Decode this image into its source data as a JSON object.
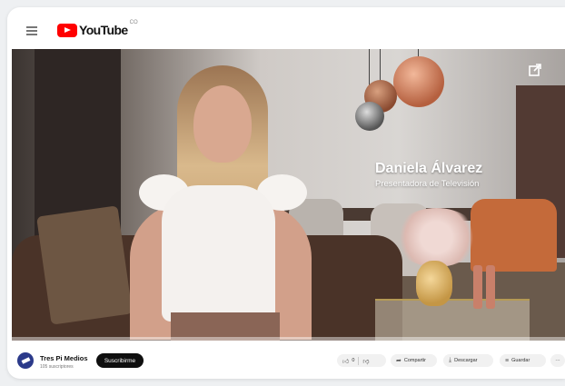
{
  "header": {
    "logo_text": "YouTube",
    "country_code": "CO"
  },
  "video": {
    "overlay_name": "Daniela Álvarez",
    "overlay_role": "Presentadora de Televisión"
  },
  "channel": {
    "name": "Tres Pi Medios",
    "subscribers": "105 suscriptores",
    "subscribe_label": "Suscribirme"
  },
  "actions": {
    "likes": "0",
    "share_label": "Compartir",
    "download_label": "Descargar",
    "save_label": "Guardar",
    "more_label": "···"
  },
  "colors": {
    "brand_red": "#ff0000",
    "subscribe_bg": "#0f0f0f",
    "pill_bg": "#f1f1f1",
    "avatar_bg": "#2b3a8a"
  },
  "icons": {
    "menu": "hamburger-icon",
    "share_overlay": "share-arrow-icon",
    "like": "thumbs-up-icon",
    "dislike": "thumbs-down-icon",
    "share": "share-icon",
    "download": "download-icon",
    "save": "playlist-add-icon"
  }
}
